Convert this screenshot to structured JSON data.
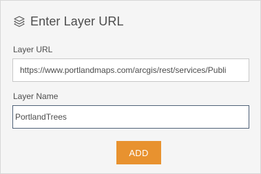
{
  "dialog": {
    "title": "Enter Layer URL",
    "icon": "layers-icon"
  },
  "form": {
    "url_label": "Layer URL",
    "url_value": "https://www.portlandmaps.com/arcgis/rest/services/Publi",
    "name_label": "Layer Name",
    "name_value": "PortlandTrees"
  },
  "actions": {
    "add_label": "ADD"
  },
  "colors": {
    "panel_background": "#f5f5f5",
    "accent": "#e8922f",
    "text": "#4c4c4c"
  }
}
